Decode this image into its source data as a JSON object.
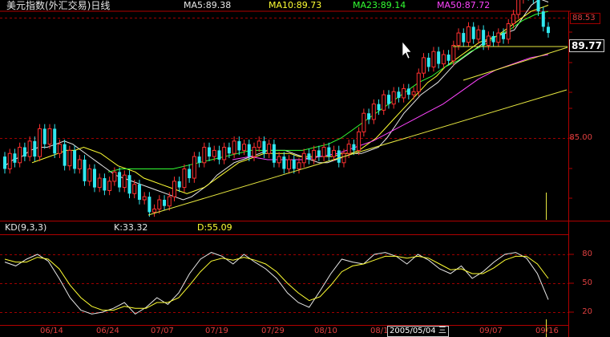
{
  "chart_data": {
    "type": "candlestick",
    "title": "美元指数(外汇交易)日线",
    "ma_labels": [
      {
        "text": "MA5:89.38",
        "color": "#e8e8e8"
      },
      {
        "text": "MA10:89.73",
        "color": "#ffff33"
      },
      {
        "text": "MA23:89.14",
        "color": "#33ff33"
      },
      {
        "text": "MA50:87.72",
        "color": "#ff44ff"
      }
    ],
    "price_labels": {
      "high_box": "88.53",
      "current_box": "89.77",
      "tick": "85.00"
    },
    "candles": [
      {
        "o": 84.4,
        "c": 84.0
      },
      {
        "o": 84.0,
        "c": 84.5
      },
      {
        "o": 84.5,
        "c": 84.2
      },
      {
        "o": 84.2,
        "c": 84.7
      },
      {
        "o": 84.7,
        "c": 84.4
      },
      {
        "o": 84.4,
        "c": 84.9
      },
      {
        "o": 84.9,
        "c": 84.4
      },
      {
        "o": 84.4,
        "c": 85.3
      },
      {
        "o": 85.3,
        "c": 84.8
      },
      {
        "o": 84.8,
        "c": 85.3
      },
      {
        "o": 85.3,
        "c": 84.5
      },
      {
        "o": 84.5,
        "c": 84.8
      },
      {
        "o": 84.8,
        "c": 84.1
      },
      {
        "o": 84.1,
        "c": 84.6
      },
      {
        "o": 84.6,
        "c": 84.0
      },
      {
        "o": 84.0,
        "c": 84.3
      },
      {
        "o": 84.3,
        "c": 83.6
      },
      {
        "o": 83.6,
        "c": 84.0
      },
      {
        "o": 84.0,
        "c": 83.4
      },
      {
        "o": 83.4,
        "c": 83.7
      },
      {
        "o": 83.7,
        "c": 83.3
      },
      {
        "o": 83.3,
        "c": 83.6
      },
      {
        "o": 83.6,
        "c": 83.9
      },
      {
        "o": 83.9,
        "c": 83.4
      },
      {
        "o": 83.4,
        "c": 83.8
      },
      {
        "o": 83.8,
        "c": 83.2
      },
      {
        "o": 83.2,
        "c": 83.5
      },
      {
        "o": 83.5,
        "c": 83.0
      },
      {
        "o": 83.0,
        "c": 83.1
      },
      {
        "o": 83.1,
        "c": 82.6
      },
      {
        "o": 82.6,
        "c": 82.7
      },
      {
        "o": 82.7,
        "c": 83.0
      },
      {
        "o": 83.0,
        "c": 82.8
      },
      {
        "o": 82.8,
        "c": 83.1
      },
      {
        "o": 83.1,
        "c": 83.6
      },
      {
        "o": 83.6,
        "c": 83.4
      },
      {
        "o": 83.4,
        "c": 84.0
      },
      {
        "o": 84.0,
        "c": 83.7
      },
      {
        "o": 83.7,
        "c": 84.4
      },
      {
        "o": 84.4,
        "c": 84.2
      },
      {
        "o": 84.2,
        "c": 84.7
      },
      {
        "o": 84.7,
        "c": 84.4
      },
      {
        "o": 84.4,
        "c": 84.6
      },
      {
        "o": 84.6,
        "c": 84.3
      },
      {
        "o": 84.3,
        "c": 84.7
      },
      {
        "o": 84.7,
        "c": 84.5
      },
      {
        "o": 84.5,
        "c": 84.9
      },
      {
        "o": 84.9,
        "c": 84.6
      },
      {
        "o": 84.6,
        "c": 84.8
      },
      {
        "o": 84.8,
        "c": 84.4
      },
      {
        "o": 84.4,
        "c": 84.7
      },
      {
        "o": 84.7,
        "c": 84.9
      },
      {
        "o": 84.9,
        "c": 84.5
      },
      {
        "o": 84.5,
        "c": 84.8
      },
      {
        "o": 84.8,
        "c": 84.2
      },
      {
        "o": 84.2,
        "c": 84.4
      },
      {
        "o": 84.4,
        "c": 84.0
      },
      {
        "o": 84.0,
        "c": 84.3
      },
      {
        "o": 84.3,
        "c": 84.0
      },
      {
        "o": 84.0,
        "c": 84.2
      },
      {
        "o": 84.2,
        "c": 84.5
      },
      {
        "o": 84.5,
        "c": 84.3
      },
      {
        "o": 84.3,
        "c": 84.6
      },
      {
        "o": 84.6,
        "c": 84.4
      },
      {
        "o": 84.4,
        "c": 84.7
      },
      {
        "o": 84.7,
        "c": 84.4
      },
      {
        "o": 84.4,
        "c": 84.6
      },
      {
        "o": 84.6,
        "c": 84.2
      },
      {
        "o": 84.2,
        "c": 84.5
      },
      {
        "o": 84.5,
        "c": 84.8
      },
      {
        "o": 84.8,
        "c": 84.6
      },
      {
        "o": 84.6,
        "c": 85.2
      },
      {
        "o": 85.2,
        "c": 85.8
      },
      {
        "o": 85.8,
        "c": 85.6
      },
      {
        "o": 85.6,
        "c": 86.1
      },
      {
        "o": 86.1,
        "c": 85.9
      },
      {
        "o": 85.9,
        "c": 86.4
      },
      {
        "o": 86.4,
        "c": 86.1
      },
      {
        "o": 86.1,
        "c": 86.5
      },
      {
        "o": 86.5,
        "c": 86.3
      },
      {
        "o": 86.3,
        "c": 86.6
      },
      {
        "o": 86.6,
        "c": 86.4
      },
      {
        "o": 86.4,
        "c": 86.5
      },
      {
        "o": 86.5,
        "c": 87.1
      },
      {
        "o": 87.1,
        "c": 87.6
      },
      {
        "o": 87.6,
        "c": 87.3
      },
      {
        "o": 87.3,
        "c": 87.8
      },
      {
        "o": 87.8,
        "c": 87.4
      },
      {
        "o": 87.4,
        "c": 87.7
      },
      {
        "o": 87.7,
        "c": 87.5
      },
      {
        "o": 87.5,
        "c": 88.0
      },
      {
        "o": 88.0,
        "c": 88.4
      },
      {
        "o": 88.4,
        "c": 88.1
      },
      {
        "o": 88.1,
        "c": 88.6
      },
      {
        "o": 88.6,
        "c": 88.2
      },
      {
        "o": 88.2,
        "c": 88.5
      },
      {
        "o": 88.5,
        "c": 88.0
      },
      {
        "o": 88.0,
        "c": 88.3
      },
      {
        "o": 88.3,
        "c": 88.1
      },
      {
        "o": 88.1,
        "c": 88.4
      },
      {
        "o": 88.4,
        "c": 88.2
      },
      {
        "o": 88.2,
        "c": 88.7
      },
      {
        "o": 88.7,
        "c": 89.0
      },
      {
        "o": 89.0,
        "c": 89.5
      },
      {
        "o": 89.5,
        "c": 89.7
      },
      {
        "o": 89.7,
        "c": 89.6
      },
      {
        "o": 89.6,
        "c": 89.5
      },
      {
        "o": 89.5,
        "c": 89.1
      },
      {
        "o": 89.1,
        "c": 88.6
      },
      {
        "o": 88.6,
        "c": 88.4
      }
    ],
    "ma_values": {
      "ma5": [
        84.1,
        84.3,
        84.4,
        84.6,
        84.7,
        84.7,
        84.8,
        84.9,
        84.8,
        84.6,
        84.4,
        84.2,
        84.0,
        83.8,
        83.7,
        83.6,
        83.5,
        83.4,
        83.3,
        83.2,
        83.1,
        83.0,
        83.1,
        83.3,
        83.5,
        83.8,
        84.0,
        84.2,
        84.3,
        84.4,
        84.5,
        84.6,
        84.6,
        84.6,
        84.5,
        84.4,
        84.3,
        84.2,
        84.2,
        84.3,
        84.4,
        84.5,
        84.5,
        84.6,
        84.7,
        85.0,
        85.4,
        85.8,
        86.1,
        86.4,
        86.6,
        86.8,
        87.1,
        87.4,
        87.6,
        87.8,
        88.0,
        88.2,
        88.3,
        88.4,
        88.5,
        88.9,
        89.3,
        89.5,
        89.4
      ],
      "ma10": [
        84.2,
        84.3,
        84.4,
        84.5,
        84.6,
        84.6,
        84.7,
        84.6,
        84.5,
        84.3,
        84.1,
        84.0,
        83.9,
        83.7,
        83.6,
        83.5,
        83.4,
        83.3,
        83.2,
        83.3,
        83.4,
        83.6,
        83.8,
        84.0,
        84.2,
        84.3,
        84.4,
        84.5,
        84.5,
        84.5,
        84.5,
        84.4,
        84.4,
        84.4,
        84.4,
        84.4,
        84.5,
        84.5,
        84.6,
        84.8,
        85.0,
        85.3,
        85.6,
        85.9,
        86.2,
        86.5,
        86.8,
        87.0,
        87.3,
        87.5,
        87.7,
        87.9,
        88.1,
        88.2,
        88.3,
        88.5,
        88.7,
        88.9,
        89.1,
        89.2,
        89.3
      ],
      "ma23": [
        83.9,
        84.0,
        84.0,
        84.0,
        84.0,
        84.0,
        84.1,
        84.2,
        84.3,
        84.4,
        84.5,
        84.6,
        84.6,
        84.6,
        84.6,
        84.6,
        84.7,
        84.8,
        85.0,
        85.3,
        85.6,
        85.9,
        86.2,
        86.5,
        86.8,
        87.0,
        87.3,
        87.5,
        87.8,
        88.0,
        88.3,
        88.5,
        88.8,
        89.0,
        89.1
      ],
      "ma50": [
        84.3,
        84.4,
        84.3,
        84.3,
        84.3,
        84.4,
        84.5,
        84.7,
        84.9,
        85.2,
        85.5,
        85.8,
        86.1,
        86.5,
        86.9,
        87.2,
        87.4,
        87.6,
        87.7
      ]
    },
    "kd_panel": {
      "title": "KD(9,3,3)",
      "k_label": "K:33.32",
      "d_label": "D:55.09",
      "levels": [
        "80",
        "50",
        "20"
      ],
      "k": [
        72,
        68,
        75,
        80,
        73,
        55,
        35,
        22,
        18,
        20,
        24,
        30,
        18,
        25,
        35,
        28,
        40,
        60,
        75,
        82,
        78,
        70,
        80,
        72,
        65,
        55,
        40,
        30,
        25,
        42,
        60,
        75,
        72,
        70,
        80,
        82,
        78,
        70,
        80,
        74,
        65,
        60,
        68,
        55,
        62,
        72,
        80,
        82,
        76,
        60,
        33
      ],
      "d": [
        75,
        72,
        72,
        77,
        75,
        65,
        48,
        35,
        26,
        22,
        22,
        26,
        24,
        24,
        30,
        30,
        35,
        48,
        62,
        73,
        76,
        74,
        77,
        74,
        70,
        62,
        50,
        40,
        32,
        36,
        48,
        62,
        68,
        70,
        74,
        78,
        78,
        76,
        78,
        76,
        70,
        64,
        65,
        60,
        60,
        66,
        74,
        78,
        78,
        70,
        55
      ]
    },
    "x_labels": [
      "06/14",
      "06/24",
      "07/07",
      "07/19",
      "07/29",
      "08/10",
      "08/19",
      "2005/05/04 三",
      "09/07",
      "09/16"
    ]
  }
}
